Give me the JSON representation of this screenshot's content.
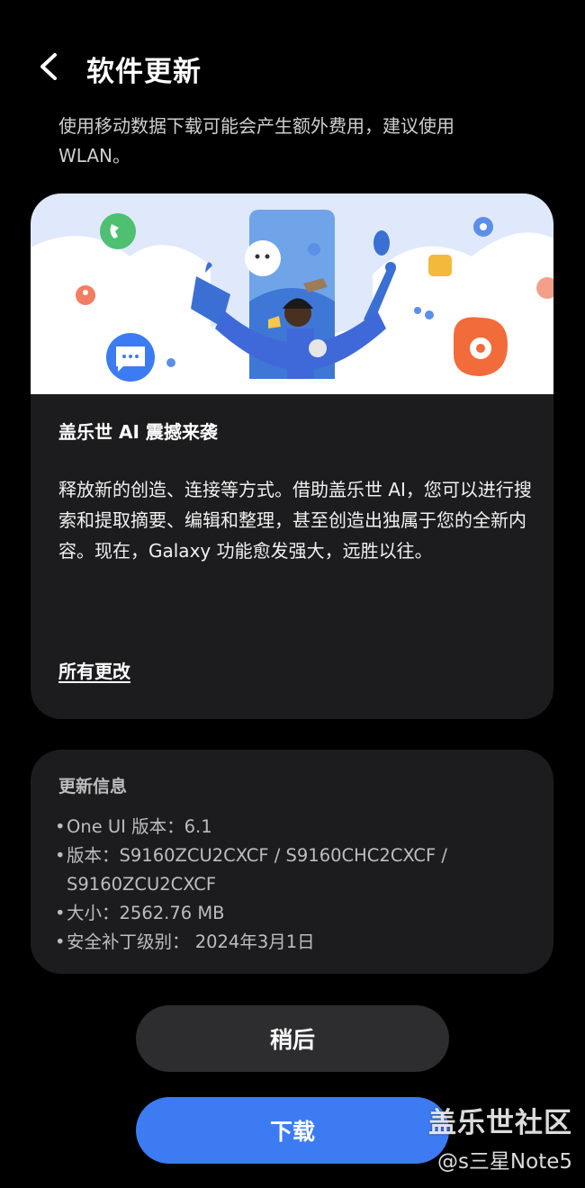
{
  "header": {
    "title": "软件更新"
  },
  "notice": "使用移动数据下载可能会产生额外费用，建议使用WLAN。",
  "feature": {
    "title": "盖乐世 AI 震撼来袭",
    "description": "释放新的创造、连接等方式。借助盖乐世 AI，您可以进行搜索和提取摘要、编辑和整理，甚至创造出独属于您的全新内容。现在，Galaxy 功能愈发强大，远胜以往。",
    "all_changes_link": "所有更改"
  },
  "update_info": {
    "title": "更新信息",
    "items": [
      "One UI 版本：6.1",
      "版本：S9160ZCU2CXCF / S9160CHC2CXCF / S9160ZCU2CXCF",
      "大小：2562.76 MB",
      "安全补丁级别： 2024年3月1日"
    ],
    "bullet": "•"
  },
  "buttons": {
    "later": "稍后",
    "download": "下载"
  },
  "watermark": {
    "line1": "盖乐世社区",
    "line2": "@s三星Note5"
  },
  "colors": {
    "background": "#000000",
    "card": "#1c1c1e",
    "later_button": "#2d2d2f",
    "download_button": "#3d7bf2",
    "secondary_text": "#bdbdbd"
  },
  "icons": [
    "back-arrow-icon",
    "phone-icon",
    "settings-icon",
    "folder-icon",
    "person-icon",
    "chat-icon",
    "flower-icon"
  ]
}
